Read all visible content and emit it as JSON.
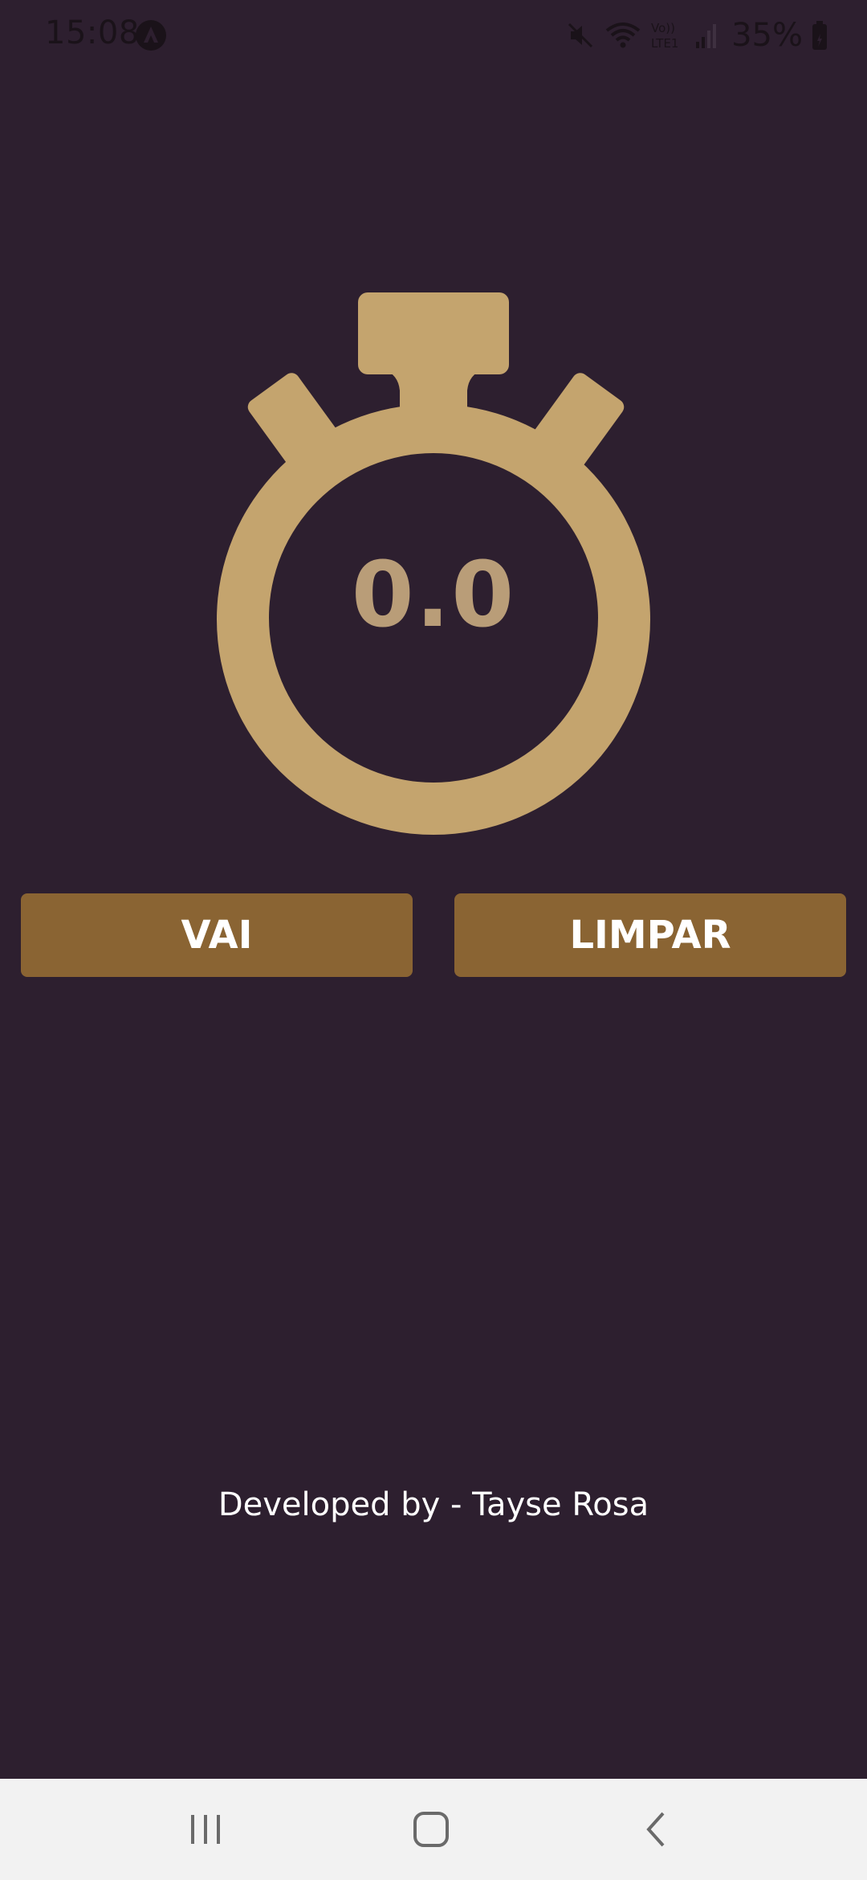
{
  "status_bar": {
    "time": "15:08",
    "battery": "35%",
    "network_label": "Vo)) LTE1",
    "icons": [
      "app-notification-icon",
      "mute-icon",
      "wifi-icon",
      "lte-icon",
      "signal-icon",
      "battery-icon"
    ]
  },
  "stopwatch": {
    "value": "0.0",
    "icon": "stopwatch-icon",
    "color": "#c4a46e"
  },
  "buttons": {
    "start_label": "VAI",
    "clear_label": "LIMPAR",
    "color": "#8a6433"
  },
  "footer": {
    "credit": "Developed by - Tayse Rosa"
  },
  "nav_bar": {
    "icons": [
      "recents-icon",
      "home-icon",
      "back-icon"
    ]
  },
  "colors": {
    "background": "#2d1f2f",
    "text": "#ffffff",
    "timer_text": "#b99d78"
  }
}
